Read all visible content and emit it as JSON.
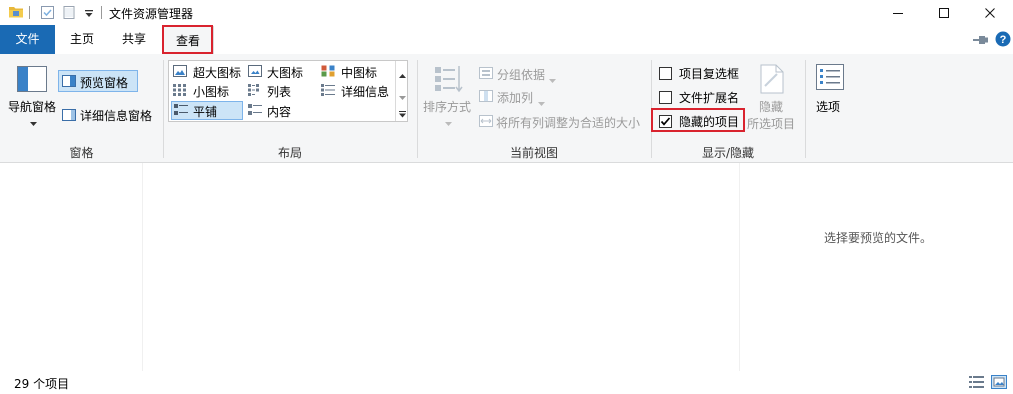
{
  "window": {
    "title": "文件资源管理器",
    "minimize": "—",
    "maximize": "☐",
    "close": "✕"
  },
  "tabs": [
    {
      "label": "文件"
    },
    {
      "label": "主页"
    },
    {
      "label": "共享"
    },
    {
      "label": "查看"
    }
  ],
  "ribbon": {
    "panes": {
      "nav_pane": "导航窗格",
      "preview_pane": "预览窗格",
      "details_pane": "详细信息窗格",
      "group_label": "窗格"
    },
    "layout": {
      "items": [
        "超大图标",
        "大图标",
        "中图标",
        "小图标",
        "列表",
        "详细信息",
        "平铺",
        "内容"
      ],
      "group_label": "布局"
    },
    "current_view": {
      "sort_by": "排序方式",
      "group_by": "分组依据",
      "add_column": "添加列",
      "fit_columns": "将所有列调整为合适的大小",
      "group_label": "当前视图"
    },
    "show_hide": {
      "item_checkboxes": "项目复选框",
      "file_extensions": "文件扩展名",
      "hidden_items": "隐藏的项目",
      "hide_selected_line1": "隐藏",
      "hide_selected_line2": "所选项目",
      "group_label": "显示/隐藏"
    },
    "options": "选项"
  },
  "preview": {
    "message": "选择要预览的文件。"
  },
  "status": {
    "count": "29 个项目"
  },
  "colors": {
    "file_tab": "#1a6ab4",
    "highlight_red": "#d9232e",
    "ribbon_bg": "#f5f6f7",
    "selected_bg": "#cce4f7"
  }
}
